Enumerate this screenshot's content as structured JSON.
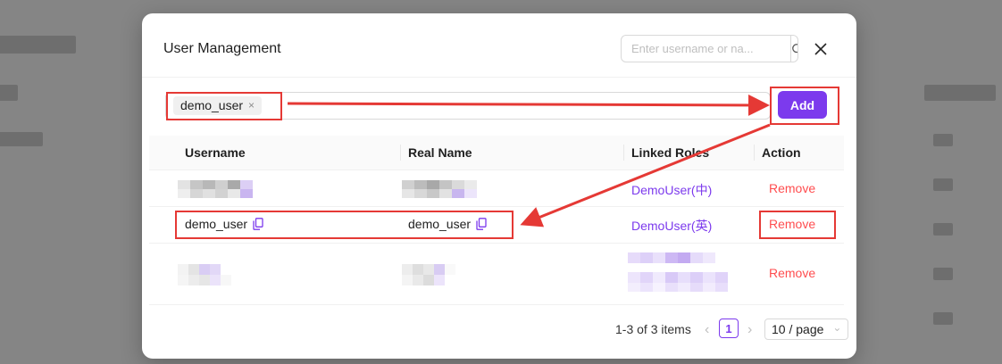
{
  "modal": {
    "title": "User Management",
    "search_placeholder": "Enter username or na...",
    "close_label": "×"
  },
  "picker": {
    "tag_label": "demo_user",
    "tag_remove": "×",
    "add_label": "Add"
  },
  "table": {
    "headers": [
      "Username",
      "Real Name",
      "Linked Roles",
      "Action"
    ],
    "rows": [
      {
        "username": "",
        "realname": "",
        "role": "DemoUser(中)",
        "action": "Remove"
      },
      {
        "username": "demo_user",
        "realname": "demo_user",
        "role": "DemoUser(英)",
        "action": "Remove"
      },
      {
        "username": "",
        "realname": "",
        "role": "",
        "action": "Remove"
      }
    ]
  },
  "pagination": {
    "summary": "1-3 of 3 items",
    "prev": "‹",
    "current_page": "1",
    "next": "›",
    "page_size": "10 / page",
    "size_chevron": "⌄"
  },
  "colors": {
    "accent": "#7c3aed",
    "danger": "#ff4d4f",
    "annotation": "#e53935"
  }
}
